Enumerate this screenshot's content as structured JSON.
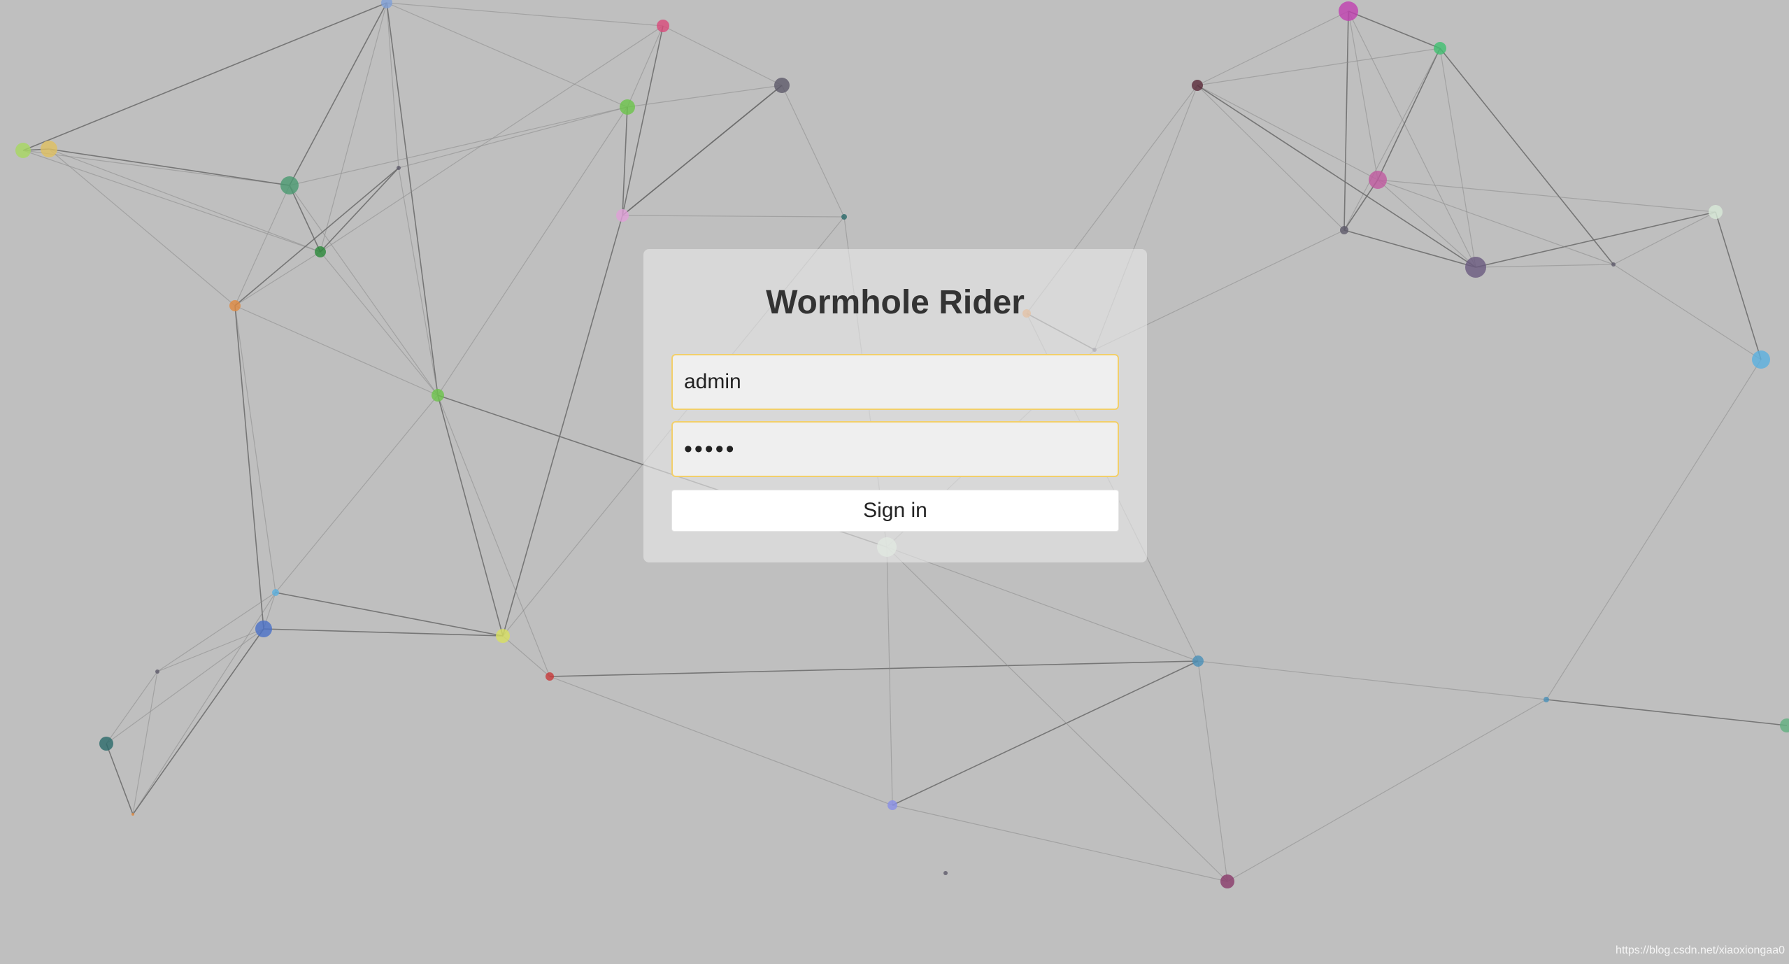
{
  "login": {
    "title": "Wormhole Rider",
    "username_value": "admin",
    "password_value": "•••••",
    "signin_label": "Sign in"
  },
  "watermark": "https://blog.csdn.net/xiaoxiongaa0",
  "background": {
    "color": "#bfbfbf",
    "node_colors": [
      "#7fa0d8",
      "#d94a7a",
      "#5e5a6a",
      "#6cc44a",
      "#a8d860",
      "#e0c060",
      "#4a9a70",
      "#2a8a3a",
      "#e08a40",
      "#e0a0d8",
      "#5ab0e0",
      "#4a70c8",
      "#d8e060",
      "#c83a3a",
      "#2a6a6a",
      "#8a90e8",
      "#4a90b8",
      "#8a3a6a",
      "#c040b0",
      "#40c070",
      "#5a2a3a",
      "#c05aa0",
      "#6a5a80",
      "#d8ead8",
      "#60b080"
    ]
  }
}
